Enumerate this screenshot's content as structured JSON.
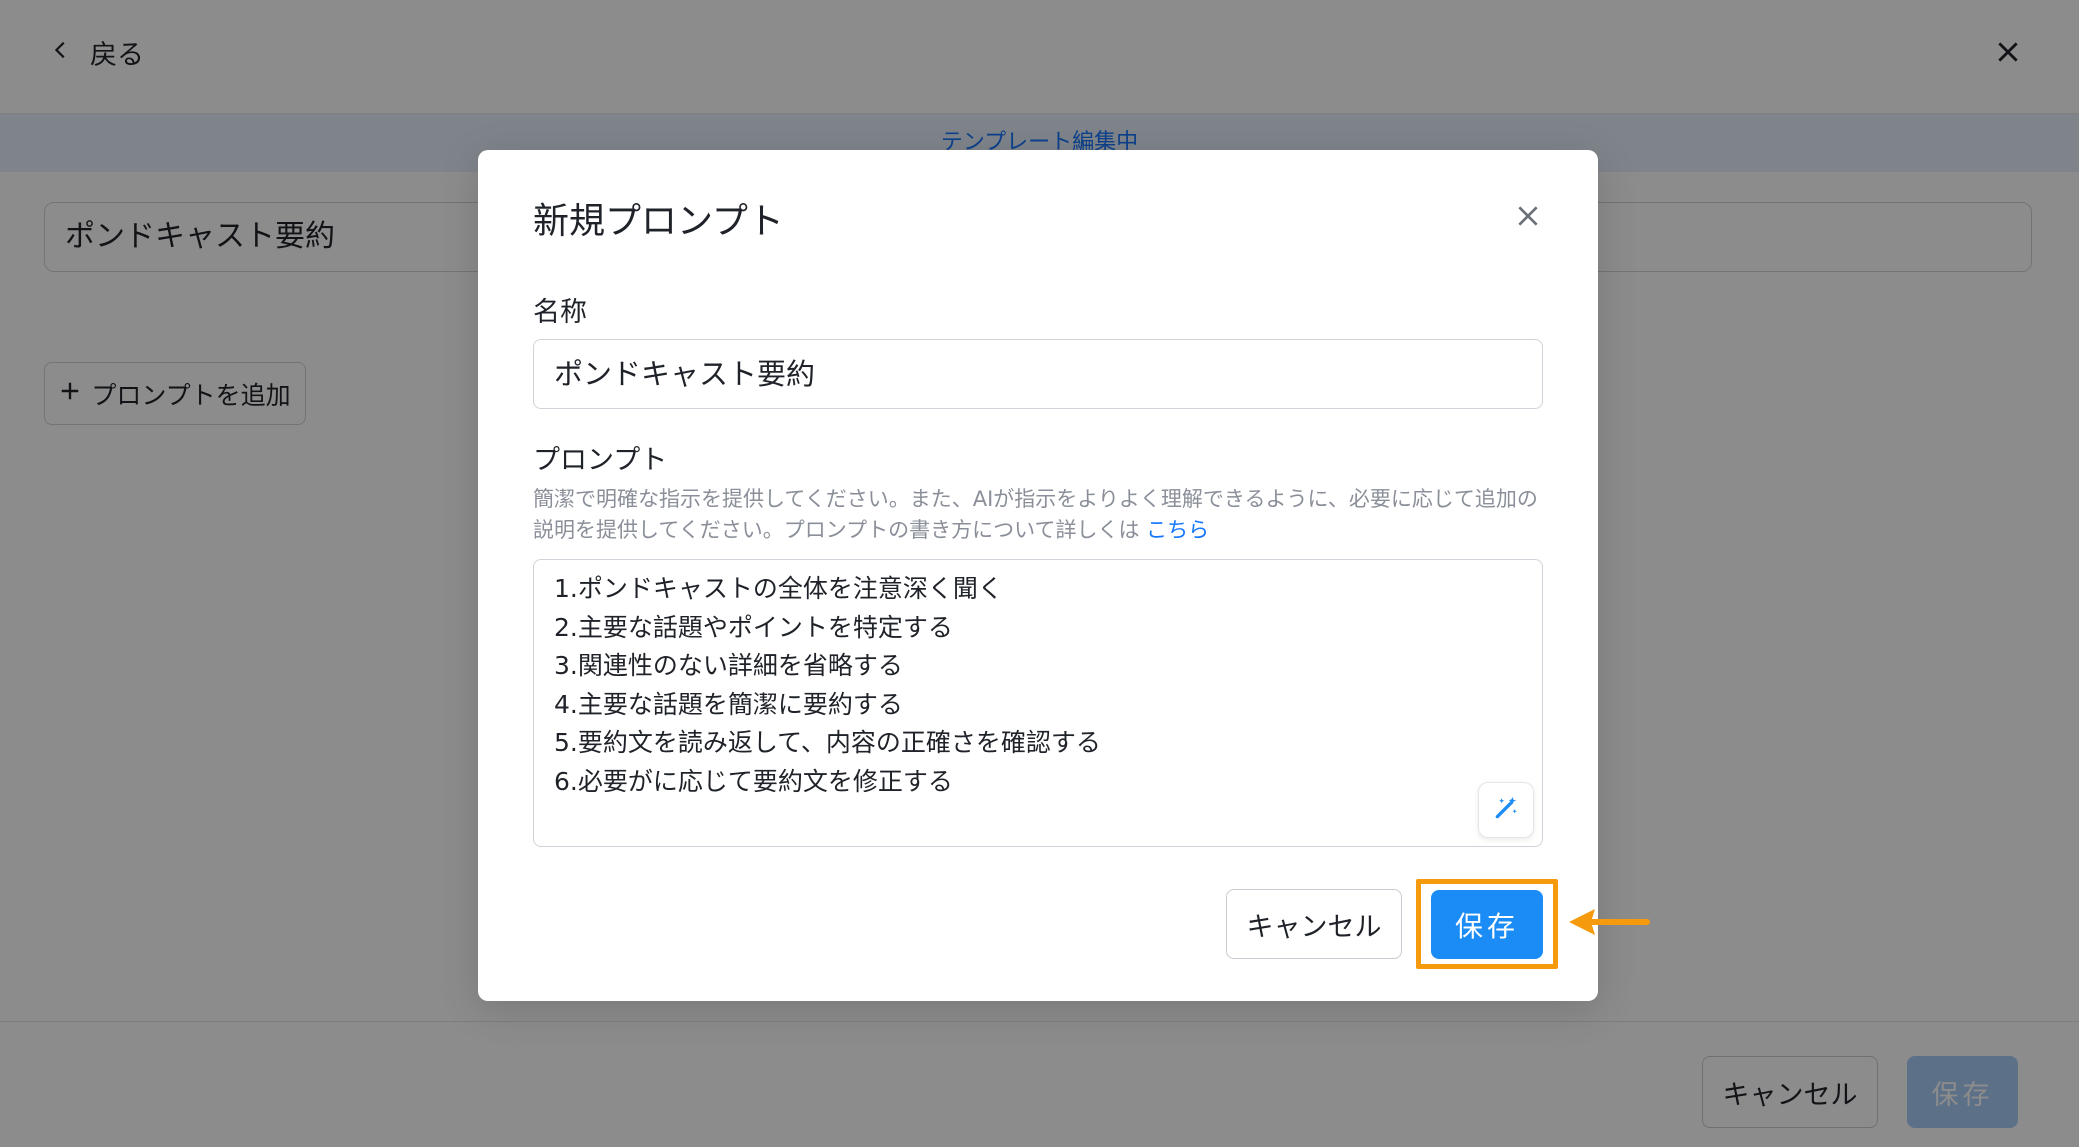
{
  "header": {
    "back_label": "戻る"
  },
  "banner": {
    "text": "テンプレート編集中"
  },
  "page": {
    "title_value": "ポンドキャスト要約",
    "add_prompt_label": "プロンプトを追加",
    "footer_cancel_label": "キャンセル",
    "footer_save_label": "保存"
  },
  "modal": {
    "title": "新規プロンプト",
    "name_label": "名称",
    "name_value": "ポンドキャスト要約",
    "prompt_label": "プロンプト",
    "help_text": "簡潔で明確な指示を提供してください。また、AIが指示をよりよく理解できるように、必要に応じて追加の説明を提供してください。プロンプトの書き方について詳しくは",
    "help_link": "こちら",
    "prompt_lines": [
      "1.ポンドキャストの全体を注意深く聞く",
      "2.主要な話題やポイントを特定する",
      "3.関連性のない詳細を省略する",
      "4.主要な話題を簡潔に要約する",
      "5.要約文を読み返して、内容の正確さを確認する",
      "6.必要がに応じて要約文を修正する"
    ],
    "cancel_label": "キャンセル",
    "save_label": "保存"
  },
  "colors": {
    "primary": "#1b8cf5",
    "highlight": "#f59a0c",
    "overlay": "rgba(0,0,0,0.45)"
  }
}
